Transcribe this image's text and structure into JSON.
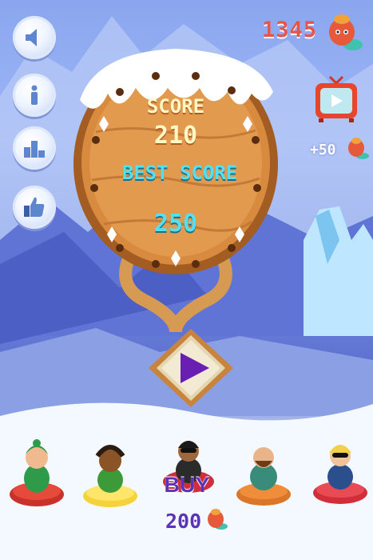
{
  "header": {
    "coin_count": "1345",
    "reward_amount": "+50"
  },
  "left_buttons": [
    {
      "icon": "speaker-icon"
    },
    {
      "icon": "info-icon"
    },
    {
      "icon": "leaderboard-icon"
    },
    {
      "icon": "thumbs-up-icon"
    }
  ],
  "sign": {
    "score_label": "SCORE",
    "score_value": "210",
    "best_label": "BEST SCORE",
    "best_value": "250"
  },
  "shop": {
    "buy_label": "BUY",
    "buy_price": "200"
  },
  "colors": {
    "accent_purple": "#6a1fb3",
    "coin_red": "#e8534a",
    "wood": "#c8782f",
    "best_cyan": "#53e0f0"
  }
}
